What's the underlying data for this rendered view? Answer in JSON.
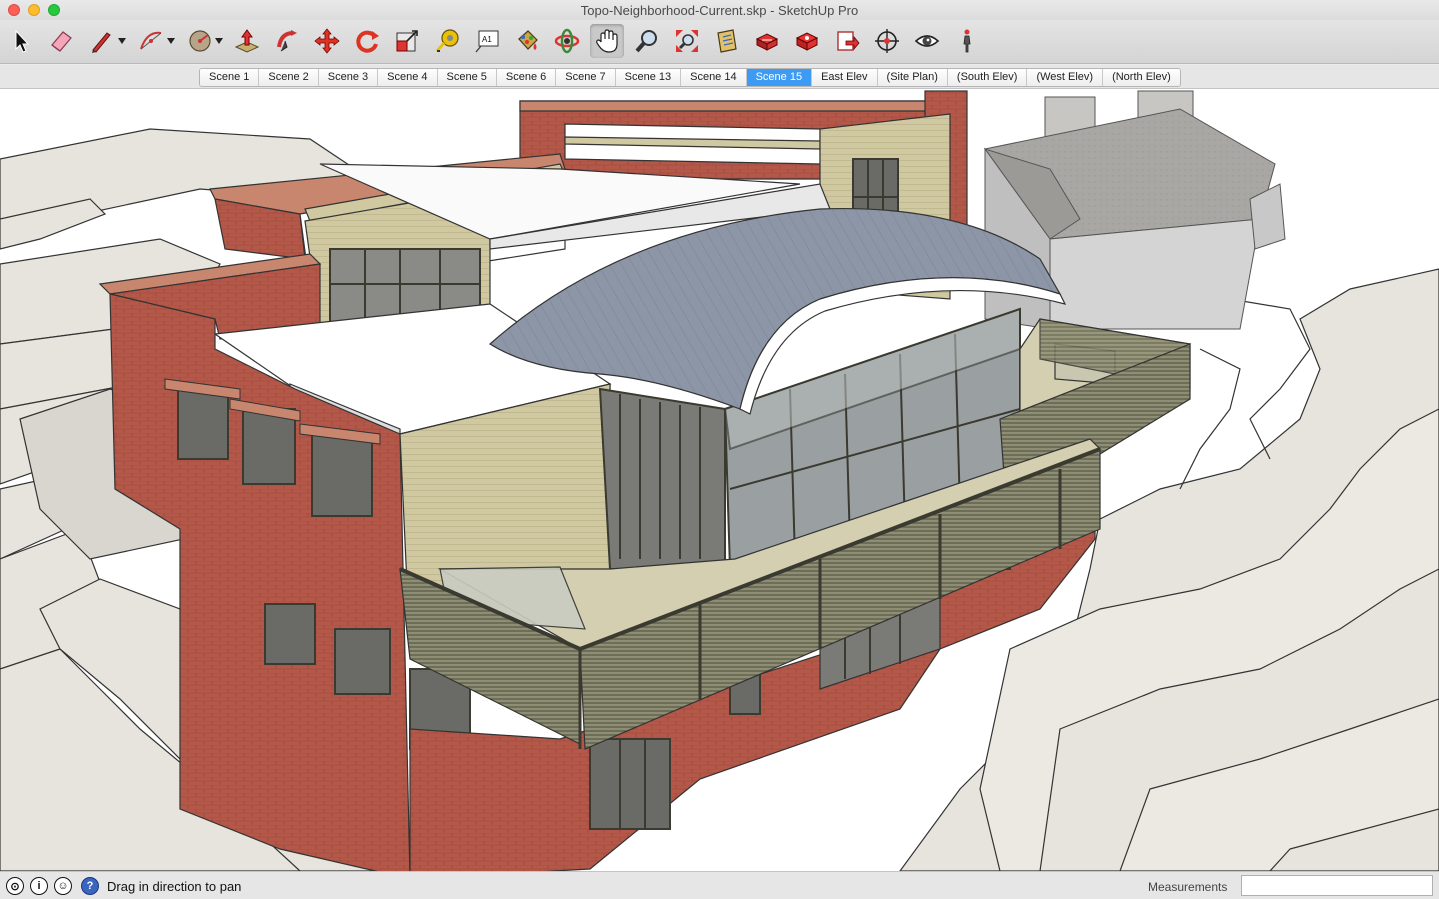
{
  "window": {
    "title": "Topo-Neighborhood-Current.skp - SketchUp Pro"
  },
  "toolbar": {
    "tools": [
      {
        "name": "select-tool-icon"
      },
      {
        "name": "eraser-tool-icon"
      },
      {
        "name": "line-tool-icon"
      },
      {
        "name": "arc-tool-icon"
      },
      {
        "name": "shapes-tool-icon"
      },
      {
        "name": "push-pull-tool-icon"
      },
      {
        "name": "follow-me-tool-icon"
      },
      {
        "name": "move-tool-icon"
      },
      {
        "name": "rotate-tool-icon"
      },
      {
        "name": "scale-tool-icon"
      },
      {
        "name": "tape-measure-tool-icon"
      },
      {
        "name": "text-tool-icon"
      },
      {
        "name": "paint-bucket-tool-icon"
      },
      {
        "name": "orbit-tool-icon"
      },
      {
        "name": "pan-tool-icon"
      },
      {
        "name": "zoom-tool-icon"
      },
      {
        "name": "zoom-extents-tool-icon"
      },
      {
        "name": "3d-warehouse-icon"
      },
      {
        "name": "extension-warehouse-icon"
      },
      {
        "name": "layout-send-icon"
      },
      {
        "name": "components-icon"
      },
      {
        "name": "position-camera-icon"
      },
      {
        "name": "look-around-icon"
      },
      {
        "name": "walk-tool-icon"
      }
    ],
    "active_tool": "pan-tool-icon"
  },
  "scenes": {
    "tabs": [
      "Scene 1",
      "Scene 2",
      "Scene 3",
      "Scene 4",
      "Scene 5",
      "Scene 6",
      "Scene 7",
      "Scene 13",
      "Scene 14",
      "Scene 15",
      "East Elev",
      "(Site Plan)",
      "(South Elev)",
      "(West Elev)",
      "(North Elev)"
    ],
    "active_index": 9
  },
  "status": {
    "message": "Drag in direction to pan",
    "measurements_label": "Measurements",
    "measurements_value": ""
  },
  "colors": {
    "active_tab": "#3d9bf3",
    "brick": "#b4584a",
    "siding": "#c8c29a",
    "roof_metal": "#8c96a6",
    "terrain": "#e6e4dc"
  }
}
